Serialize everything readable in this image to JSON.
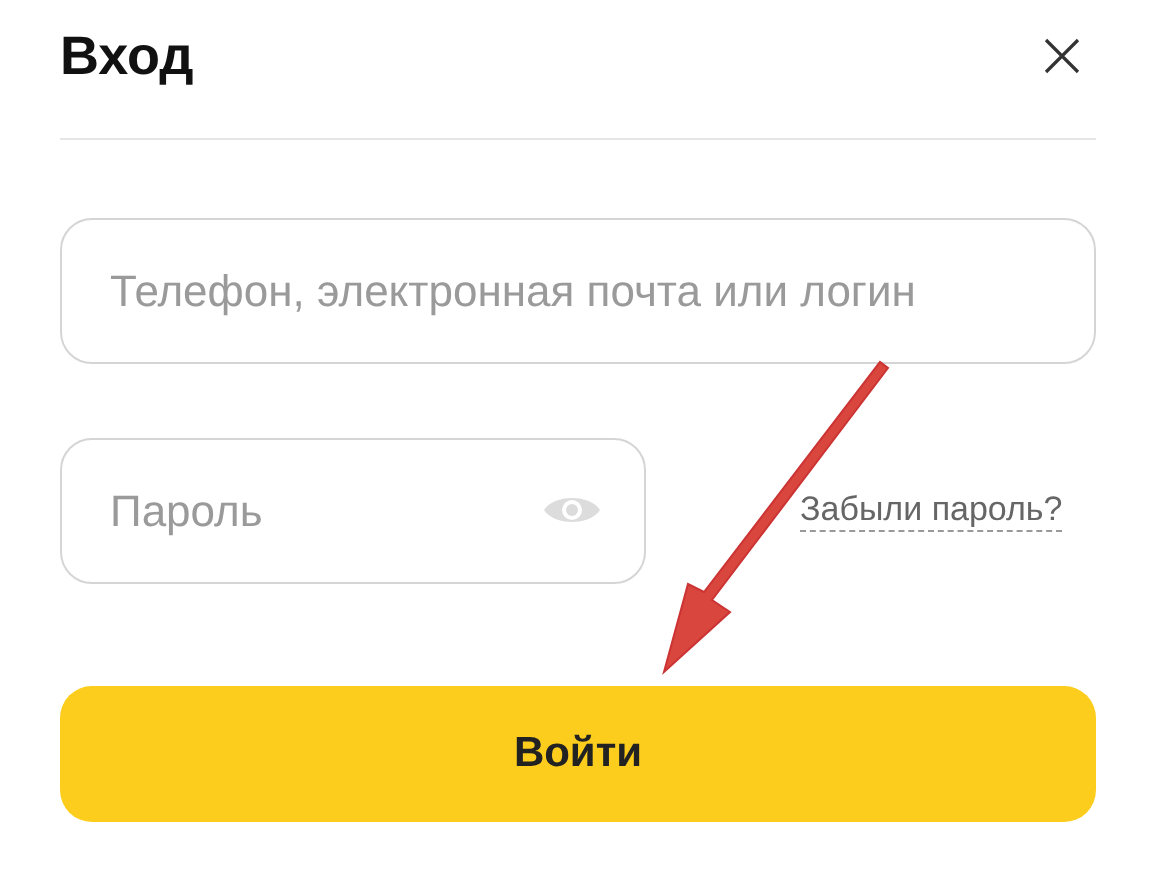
{
  "dialog": {
    "title": "Вход"
  },
  "login_field": {
    "placeholder": "Телефон, электронная почта или логин"
  },
  "password_field": {
    "placeholder": "Пароль"
  },
  "forgot_link": "Забыли пароль?",
  "submit_button": "Войти"
}
